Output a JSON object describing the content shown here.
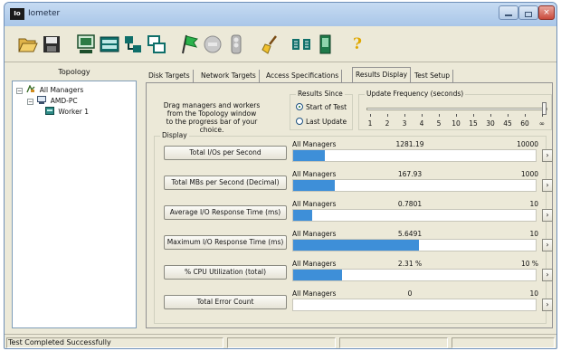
{
  "window": {
    "app_badge": "Io",
    "title": "Iometer",
    "close_glyph": "×"
  },
  "toolbar": {
    "buttons": [
      {
        "name": "open-config-button",
        "icon": "folder-open-icon"
      },
      {
        "name": "save-config-button",
        "icon": "floppy-disk-icon"
      },
      {
        "name": "new-manager-button",
        "icon": "monitor-icon"
      },
      {
        "name": "new-disk-worker-button",
        "icon": "disk-worker-icon"
      },
      {
        "name": "new-network-worker-button",
        "icon": "network-worker-icon"
      },
      {
        "name": "duplicate-worker-button",
        "icon": "copy-worker-icon"
      },
      {
        "name": "start-tests-button",
        "icon": "green-flag-icon"
      },
      {
        "name": "stop-current-test-button",
        "icon": "stop-sign-icon"
      },
      {
        "name": "stop-all-tests-button",
        "icon": "stoplight-icon"
      },
      {
        "name": "reset-workers-button",
        "icon": "broom-icon"
      },
      {
        "name": "disconnect-manager-button",
        "icon": "disconnect-icon"
      },
      {
        "name": "exit-button",
        "icon": "exit-door-icon"
      },
      {
        "name": "about-button",
        "icon": "question-mark-icon"
      }
    ],
    "about_glyph": "?"
  },
  "topology": {
    "heading": "Topology",
    "tree": [
      {
        "label": "All Managers",
        "expander": "−"
      },
      {
        "label": "AMD-PC",
        "expander": "−"
      },
      {
        "label": "Worker 1"
      }
    ]
  },
  "tabs": [
    {
      "label": "Disk Targets",
      "active": false
    },
    {
      "label": "Network Targets",
      "active": false
    },
    {
      "label": "Access Specifications",
      "active": false
    },
    {
      "label": "Results Display",
      "active": true
    },
    {
      "label": "Test Setup",
      "active": false
    }
  ],
  "results": {
    "hint": [
      "Drag managers and workers",
      "from the Topology window",
      "to the progress bar of your choice."
    ],
    "since": {
      "title": "Results Since",
      "options": [
        {
          "label": "Start of Test",
          "selected": true
        },
        {
          "label": "Last Update",
          "selected": false
        }
      ]
    },
    "update": {
      "title": "Update Frequency (seconds)",
      "ticks": [
        "1",
        "2",
        "3",
        "4",
        "5",
        "10",
        "15",
        "30",
        "45",
        "60",
        "∞"
      ],
      "selected": "∞"
    },
    "display_title": "Display",
    "metrics": [
      {
        "button": "Total I/Os per Second",
        "source": "All Managers",
        "value": "1281.19",
        "max": "10000",
        "fraction": 0.13
      },
      {
        "button": "Total MBs per Second (Decimal)",
        "source": "All Managers",
        "value": "167.93",
        "max": "1000",
        "fraction": 0.17
      },
      {
        "button": "Average I/O Response Time (ms)",
        "source": "All Managers",
        "value": "0.7801",
        "max": "10",
        "fraction": 0.08
      },
      {
        "button": "Maximum I/O Response Time (ms)",
        "source": "All Managers",
        "value": "5.6491",
        "max": "10",
        "fraction": 0.52
      },
      {
        "button": "% CPU Utilization (total)",
        "source": "All Managers",
        "value": "2.31 %",
        "max": "10 %",
        "fraction": 0.2
      },
      {
        "button": "Total Error Count",
        "source": "All Managers",
        "value": "0",
        "max": "10",
        "fraction": 0
      }
    ],
    "scale_glyph": "›"
  },
  "status": {
    "text": "Test Completed Successfully"
  },
  "colors": {
    "bar_fill": "#3e8fd8",
    "window_chrome": "#b9d0ea",
    "dialog_face": "#ece9d8"
  }
}
